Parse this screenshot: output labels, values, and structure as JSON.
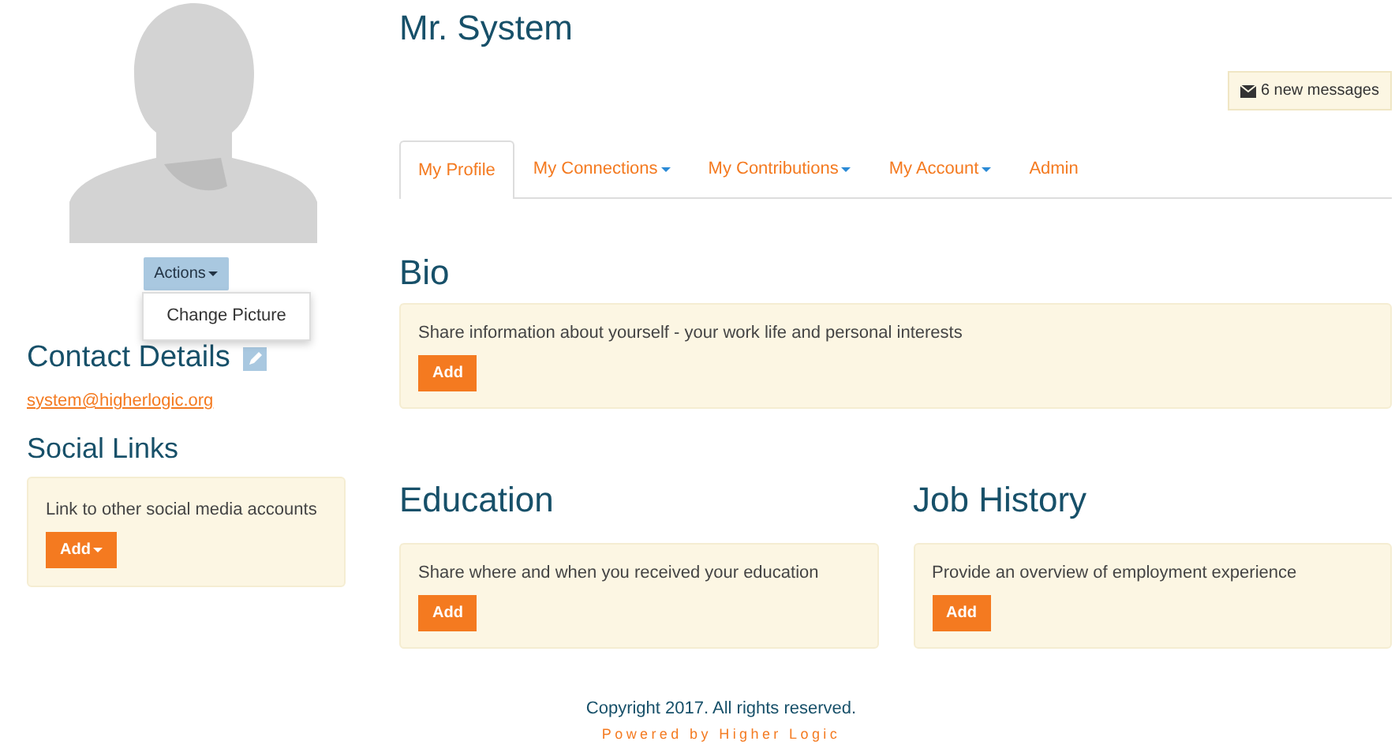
{
  "sidebar": {
    "actions": {
      "label": "Actions",
      "menu": [
        "Change Picture"
      ]
    },
    "contact": {
      "title": "Contact Details",
      "email": "system@higherlogic.org"
    },
    "social": {
      "title": "Social Links",
      "text": "Link to other social media accounts",
      "button": {
        "label": "Add",
        "dropdown": true
      }
    }
  },
  "profile": {
    "name": "Mr. System",
    "messages": "6 new messages",
    "tabs": [
      {
        "label": "My Profile",
        "selected": true,
        "dropdown": false
      },
      {
        "label": "My Connections",
        "selected": false,
        "dropdown": true
      },
      {
        "label": "My Contributions",
        "selected": false,
        "dropdown": true
      },
      {
        "label": "My Account",
        "selected": false,
        "dropdown": true
      },
      {
        "label": "Admin",
        "selected": false,
        "dropdown": false
      }
    ],
    "sections": [
      {
        "title": "Bio",
        "text": "Share information about yourself - your work life and personal interests",
        "button": {
          "label": "Add",
          "dropdown": false
        }
      },
      {
        "title": "Education",
        "text": "Share where and when you received your education",
        "button": {
          "label": "Add",
          "dropdown": false
        }
      },
      {
        "title": "Job History",
        "text": "Provide an overview of employment experience",
        "button": {
          "label": "Add",
          "dropdown": false
        }
      }
    ]
  },
  "footer": {
    "copyright": "Copyright 2017. All rights reserved.",
    "powered": "Powered by Higher Logic"
  }
}
